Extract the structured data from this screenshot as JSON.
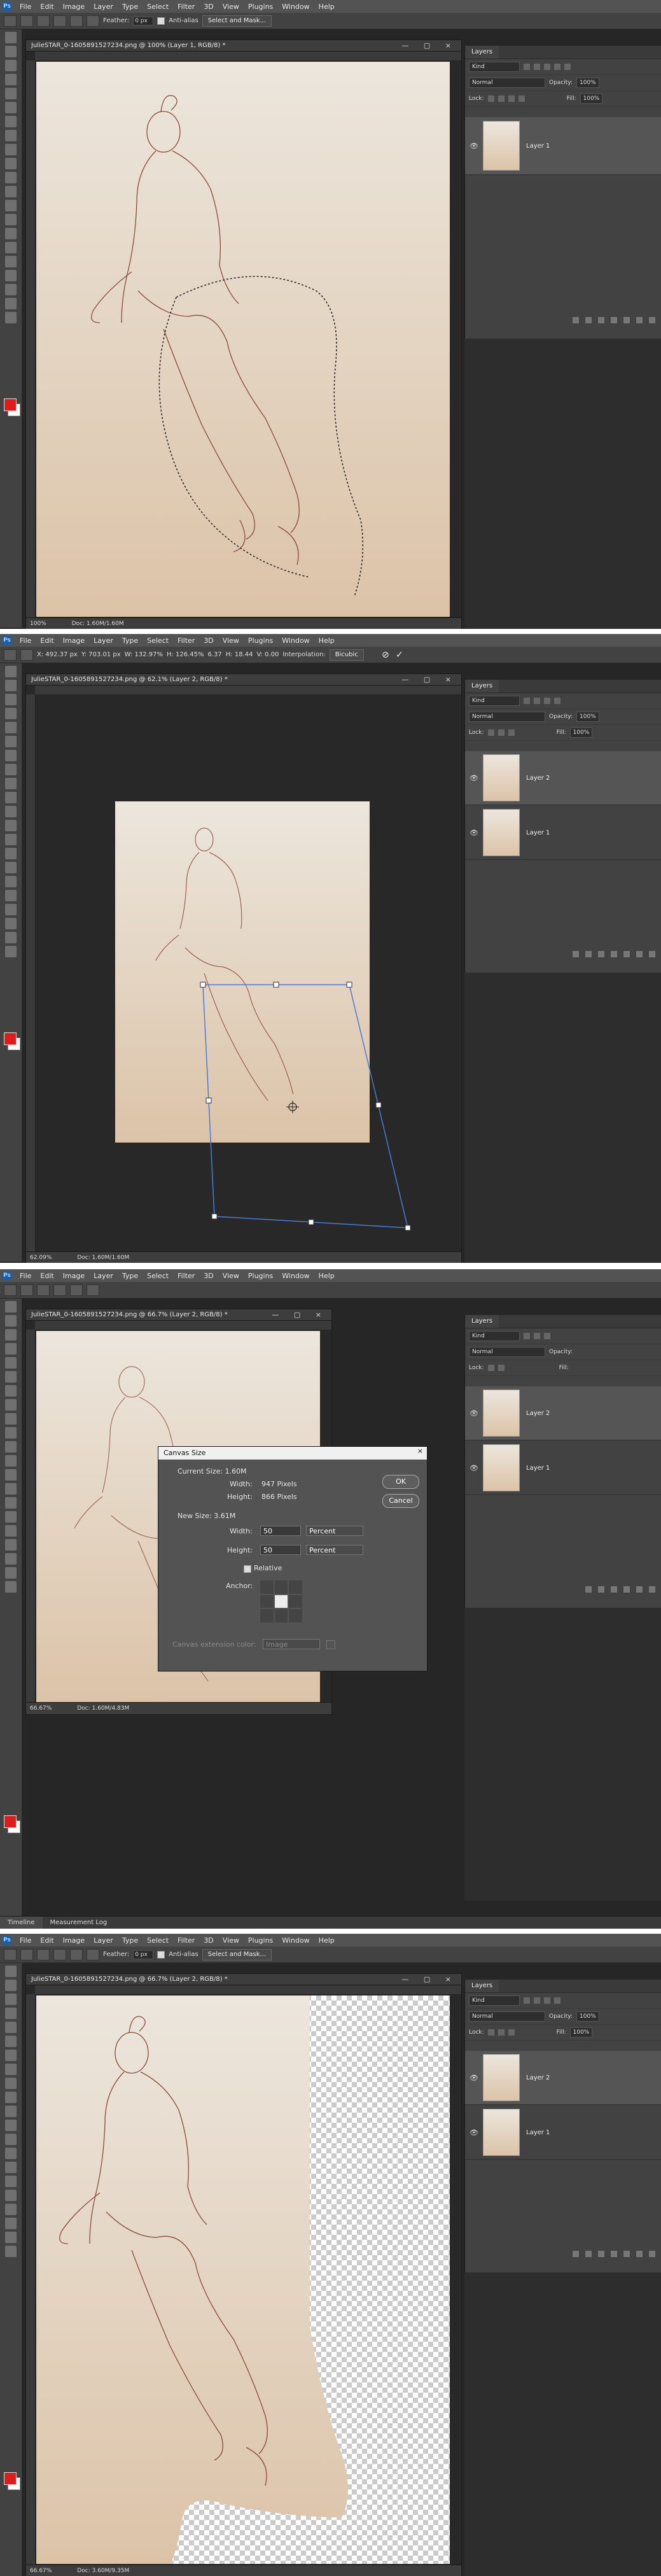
{
  "menu": [
    "File",
    "Edit",
    "Image",
    "Layer",
    "Type",
    "Select",
    "Filter",
    "3D",
    "View",
    "Plugins",
    "Window",
    "Help"
  ],
  "ps_logo": "Ps",
  "screens": [
    {
      "options": {
        "feather_label": "Feather:",
        "feather_value": "0 px",
        "antialias_label": "Anti-alias",
        "select_mask_label": "Select and Mask..."
      },
      "doc_tab": "JulieSTAR_0-1605891527234.png @ 100% (Layer 1, RGB/8) *",
      "status_zoom": "100%",
      "status_doc": "Doc: 1.60M/1.60M"
    },
    {
      "options": {
        "x": "X: 492.37 px",
        "y": "Y: 703.01 px",
        "w": "W: 132.97%",
        "h": "H: 126.45%",
        "angle": "6.37",
        "hskew": "H: 18.44",
        "vskew": "V: 0.00",
        "interp_label": "Interpolation:",
        "interp_value": "Bicubic"
      },
      "doc_tab": "JulieSTAR_0-1605891527234.png @ 62.1% (Layer 2, RGB/8) *",
      "status_zoom": "62.09%",
      "status_doc": "Doc: 1.60M/1.60M"
    },
    {
      "doc_tab": "JulieSTAR_0-1605891527234.png @ 66.7% (Layer 2, RGB/8) *",
      "status_zoom": "66.67%",
      "status_doc": "Doc: 1.60M/4.83M",
      "dialog": {
        "title": "Canvas Size",
        "close": "×",
        "current_size": "Current Size: 1.60M",
        "width_label": "Width:",
        "width_value": "947 Pixels",
        "height_label": "Height:",
        "height_value": "866 Pixels",
        "new_size": "New Size: 3.61M",
        "new_width": "50",
        "new_height": "50",
        "unit": "Percent",
        "relative": "Relative",
        "anchor": "Anchor:",
        "extension_label": "Canvas extension color:",
        "extension_value": "Image",
        "ok": "OK",
        "cancel": "Cancel"
      },
      "bottom_tabs": [
        "Timeline",
        "Measurement Log"
      ]
    },
    {
      "options": {
        "feather_label": "Feather:",
        "feather_value": "0 px",
        "antialias_label": "Anti-alias",
        "select_mask_label": "Select and Mask..."
      },
      "doc_tab": "JulieSTAR_0-1605891527234.png @ 66.7% (Layer 2, RGB/8) *",
      "status_zoom": "66.67%",
      "status_doc": "Doc: 3.60M/9.35M"
    }
  ],
  "layers_panel": {
    "tab": "Layers",
    "filter": "Kind",
    "blend": "Normal",
    "opacity_label": "Opacity:",
    "opacity_value": "100%",
    "lock_label": "Lock:",
    "fill_label": "Fill:",
    "fill_value": "100%",
    "layer1": "Layer 1",
    "layer2": "Layer 2",
    "eye": "👁"
  },
  "icons": {
    "close": "×",
    "commit": "✓",
    "cancel": "⊘"
  }
}
